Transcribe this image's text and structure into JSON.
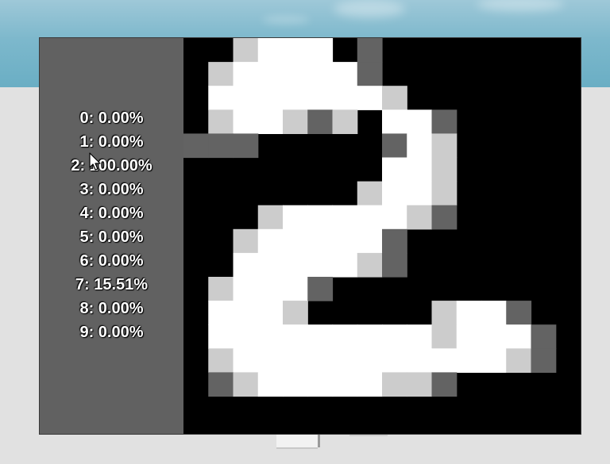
{
  "predictions": [
    {
      "label": "0: 0.00%"
    },
    {
      "label": "1: 0.00%"
    },
    {
      "label": "2: 100.00%"
    },
    {
      "label": "3: 0.00%"
    },
    {
      "label": "4: 0.00%"
    },
    {
      "label": "5: 0.00%"
    },
    {
      "label": "6: 0.00%"
    },
    {
      "label": "7: 15.51%"
    },
    {
      "label": "8: 0.00%"
    },
    {
      "label": "9: 0.00%"
    }
  ],
  "drawing_grid": {
    "columns": 16,
    "rows": 16,
    "legend": {
      "0": "#000000",
      "1": "#636363",
      "2": "#cccccc",
      "3": "#ffffff"
    },
    "cells": [
      "0023330100000000",
      "0233333100000000",
      "0333333320000000",
      "0233212033100000",
      "1110000013200000",
      "0000000033200000",
      "0000000233200000",
      "0002333332100000",
      "0023333310000000",
      "0033333210000000",
      "0233310000000000",
      "0333200000233100",
      "0333333333233310",
      "0233333333333210",
      "0123333322100000",
      "0000000000000000"
    ]
  }
}
